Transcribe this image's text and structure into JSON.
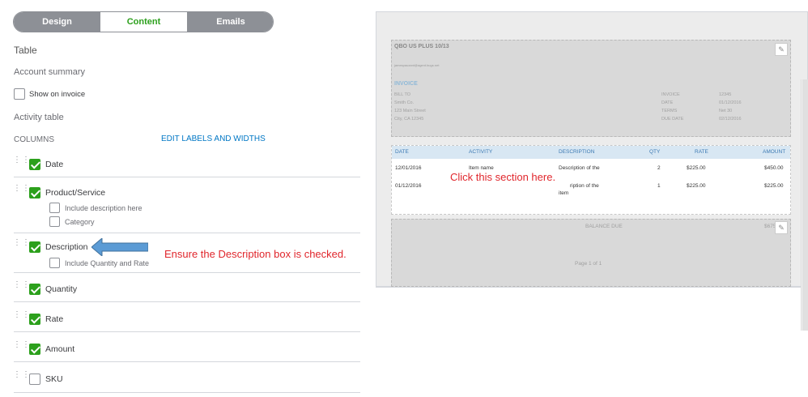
{
  "tabs": [
    {
      "label": "Design"
    },
    {
      "label": "Content"
    },
    {
      "label": "Emails"
    }
  ],
  "section": {
    "title": "Table",
    "account_summary": "Account summary",
    "show_on_invoice": "Show on invoice",
    "activity_table": "Activity table",
    "columns": "COLUMNS",
    "edit_link": "EDIT LABELS AND WIDTHS"
  },
  "columns": [
    {
      "label": "Date",
      "checked": true
    },
    {
      "label": "Product/Service",
      "checked": true
    },
    {
      "label": "Description",
      "checked": true
    },
    {
      "label": "Quantity",
      "checked": true
    },
    {
      "label": "Rate",
      "checked": true
    },
    {
      "label": "Amount",
      "checked": true
    },
    {
      "label": "SKU",
      "checked": false
    }
  ],
  "sub_options": {
    "include_description": "Include description here",
    "category": "Category",
    "include_qty_rate": "Include Quantity and Rate"
  },
  "annotations": {
    "description_note": "Ensure the Description box is checked.",
    "click_note": "Click this section here."
  },
  "preview": {
    "company": "QBO US PLUS 10/13",
    "email": "jamespauzant@agent.bugs.net",
    "invoice_title": "INVOICE",
    "bill_to": [
      "BILL TO",
      "Smith Co.",
      "123 Main Street",
      "City, CA 12345"
    ],
    "meta_labels": [
      "INVOICE",
      "DATE",
      "TERMS",
      "DUE DATE"
    ],
    "meta_values": [
      "12345",
      "01/12/2016",
      "Net 30",
      "02/12/2016"
    ],
    "table_headers": [
      "DATE",
      "ACTIVITY",
      "DESCRIPTION",
      "QTY",
      "RATE",
      "AMOUNT"
    ],
    "rows": [
      {
        "date": "12/01/2016",
        "activity": "Item name",
        "description": "Description of the",
        "qty": "2",
        "rate": "$225.00",
        "amount": "$450.00"
      },
      {
        "date": "01/12/2016",
        "activity": "",
        "description": "ription of the",
        "description2": "item",
        "qty": "1",
        "rate": "$225.00",
        "amount": "$225.00"
      }
    ],
    "balance_due": "BALANCE DUE",
    "balance_amount": "$675",
    "page": "Page 1 of 1"
  },
  "colors": {
    "accent": "#2ca01c",
    "link": "#0077c5",
    "annotation": "#e0262c",
    "arrow": "#5b9bd5"
  }
}
